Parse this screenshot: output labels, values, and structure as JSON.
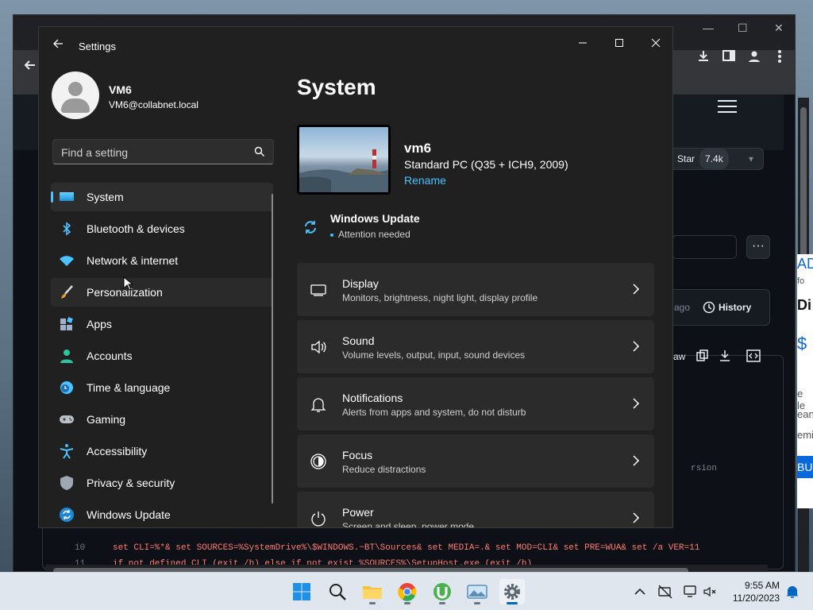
{
  "settings": {
    "app_title": "Settings",
    "user": {
      "name": "VM6",
      "email": "VM6@collabnet.local"
    },
    "search_placeholder": "Find a setting",
    "nav": [
      {
        "label": "System",
        "icon": "display-icon",
        "active": true
      },
      {
        "label": "Bluetooth & devices",
        "icon": "bluetooth-icon"
      },
      {
        "label": "Network & internet",
        "icon": "wifi-icon"
      },
      {
        "label": "Personalization",
        "icon": "paintbrush-icon"
      },
      {
        "label": "Apps",
        "icon": "apps-icon"
      },
      {
        "label": "Accounts",
        "icon": "person-icon"
      },
      {
        "label": "Time & language",
        "icon": "clock-globe-icon"
      },
      {
        "label": "Gaming",
        "icon": "gamepad-icon"
      },
      {
        "label": "Accessibility",
        "icon": "accessibility-icon"
      },
      {
        "label": "Privacy & security",
        "icon": "shield-icon"
      },
      {
        "label": "Windows Update",
        "icon": "update-icon"
      }
    ],
    "page_title": "System",
    "device": {
      "name": "vm6",
      "model": "Standard PC (Q35 + ICH9, 2009)",
      "rename": "Rename"
    },
    "windows_update": {
      "title": "Windows Update",
      "status": "Attention needed"
    },
    "cards": [
      {
        "title": "Display",
        "subtitle": "Monitors, brightness, night light, display profile",
        "icon": "monitor-icon"
      },
      {
        "title": "Sound",
        "subtitle": "Volume levels, output, input, sound devices",
        "icon": "speaker-icon"
      },
      {
        "title": "Notifications",
        "subtitle": "Alerts from apps and system, do not disturb",
        "icon": "bell-icon"
      },
      {
        "title": "Focus",
        "subtitle": "Reduce distractions",
        "icon": "focus-icon"
      },
      {
        "title": "Power",
        "subtitle": "Screen and sleep, power mode",
        "icon": "power-icon"
      }
    ]
  },
  "browser": {
    "star_label": "Star",
    "star_count": "7.4k",
    "history_label": "History",
    "ago_text": "ago",
    "raw_label": "aw",
    "version_text": "rsion",
    "code_lines": [
      {
        "num": "10",
        "text": "set CLI=%*& set SOURCES=%SystemDrive%\\$WINDOWS.~BT\\Sources& set MEDIA=.& set MOD=CLI& set PRE=WUA& set /a VER=11"
      },
      {
        "num": "11",
        "text": "if not defined CLI (exit /b) else if not exist %SOURCES%\\SetupHost.exe (exit /b)"
      }
    ],
    "side_text": [
      "AD",
      "fo",
      "Di",
      "$",
      "e le",
      "ean",
      "emi",
      "BU"
    ]
  },
  "taskbar": {
    "apps": [
      "windows-start-icon",
      "search-icon",
      "file-explorer-icon",
      "chrome-icon",
      "utorrent-icon",
      "photos-icon",
      "settings-gear-icon"
    ],
    "time": "9:55 AM",
    "date": "11/20/2023"
  }
}
